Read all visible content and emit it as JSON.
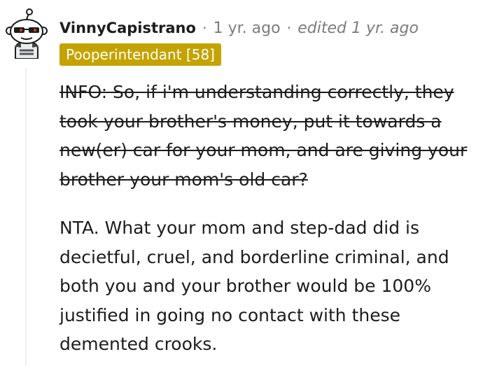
{
  "comment": {
    "author": "VinnyCapistrano",
    "separator": "·",
    "time": "1 yr. ago",
    "edited": "edited 1 yr. ago",
    "flair": "Pooperintendant [58]",
    "struck_text": "INFO: So, if i'm understanding correctly, they took your brother's money, put it towards a new(er) car for your mom, and are giving your brother your mom's old car?",
    "body_text": "NTA. What your mom and step-dad did is decietful, cruel, and borderline criminal, and both you and your brother would be 100% justified in going no contact with these demented crooks."
  },
  "colors": {
    "flair_background": "#c4a300",
    "meta_text": "#7c7c7c",
    "body_text": "#1c1c1c",
    "thread_line": "#edeff1"
  },
  "icons": {
    "avatar": "snoo-avatar-with-glasses-icon"
  }
}
